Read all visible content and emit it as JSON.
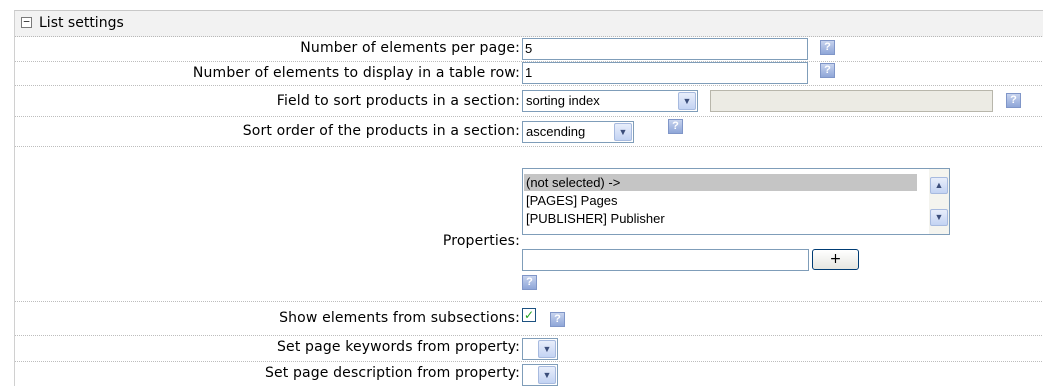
{
  "section": {
    "title": "List settings",
    "toggle_symbol": "−"
  },
  "fields": {
    "elements_per_page": {
      "label": "Number of elements per page:",
      "value": "5"
    },
    "elements_per_row": {
      "label": "Number of elements to display in a table row:",
      "value": "1"
    },
    "sort_field": {
      "label": "Field to sort products in a section:",
      "value": "sorting index"
    },
    "sort_order": {
      "label": "Sort order of the products in a section:",
      "value": "ascending"
    },
    "properties": {
      "label": "Properties:",
      "options": [
        "(not selected) ->",
        "[PAGES] Pages",
        "[PUBLISHER] Publisher"
      ],
      "selected_index": 0,
      "add_value": "",
      "add_button_label": "+"
    },
    "show_subsections": {
      "label": "Show elements from subsections:",
      "checked": true
    },
    "keywords_property": {
      "label": "Set page keywords from property:",
      "value": ""
    },
    "description_property": {
      "label": "Set page description from property:",
      "value": ""
    }
  },
  "icons": {
    "help": "?",
    "dropdown_arrow": "▼",
    "scroll_up": "▲",
    "scroll_down": "▼",
    "check": "✓"
  },
  "colors": {
    "header_bg": "#f2f2f2",
    "input_border": "#7f9db9",
    "help_bg": "#9db0e0",
    "selected_option_bg": "#c5c5c5",
    "checkmark": "#21a121"
  }
}
